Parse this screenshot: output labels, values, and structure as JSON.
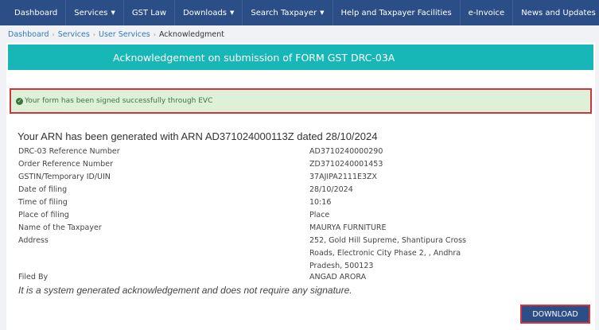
{
  "nav": {
    "items": [
      {
        "label": "Dashboard",
        "dropdown": false
      },
      {
        "label": "Services",
        "dropdown": true
      },
      {
        "label": "GST Law",
        "dropdown": false
      },
      {
        "label": "Downloads",
        "dropdown": true
      },
      {
        "label": "Search Taxpayer",
        "dropdown": true
      },
      {
        "label": "Help and Taxpayer Facilities",
        "dropdown": false
      },
      {
        "label": "e-Invoice",
        "dropdown": false
      },
      {
        "label": "News and Updates",
        "dropdown": false
      }
    ]
  },
  "breadcrumb": {
    "items": [
      "Dashboard",
      "Services",
      "User Services"
    ],
    "current": "Acknowledgment"
  },
  "page": {
    "title": "Acknowledgement on submission of FORM GST DRC-03A",
    "alert": "Your form has been signed successfully through EVC",
    "arn_heading": "Your ARN has been generated with ARN AD371024000113Z dated 28/10/2024",
    "details": [
      {
        "label": "DRC-03 Reference Number",
        "value": "AD3710240000290"
      },
      {
        "label": "Order Reference Number",
        "value": "ZD3710240001453"
      },
      {
        "label": "GSTIN/Temporary ID/UIN",
        "value": "37AJIPA2111E3ZX"
      },
      {
        "label": "Date of filing",
        "value": "28/10/2024"
      },
      {
        "label": "Time of filing",
        "value": "10:16"
      },
      {
        "label": "Place of filing",
        "value": "Place"
      },
      {
        "label": "Name of the Taxpayer",
        "value": "MAURYA FURNITURE"
      },
      {
        "label": "Address",
        "value": "252, Gold Hill Supreme, Shantipura Cross Roads, Electronic City Phase 2, , Andhra Pradesh, 500123"
      },
      {
        "label": "Filed By",
        "value": "ANGAD ARORA"
      }
    ],
    "note": "It is a system generated acknowledgement and does not require any signature.",
    "download_label": "DOWNLOAD"
  },
  "colors": {
    "nav_bg": "#2c4e86",
    "title_bg": "#17b7b8",
    "alert_bg": "#dff0d8",
    "highlight_border": "#d0343c"
  }
}
